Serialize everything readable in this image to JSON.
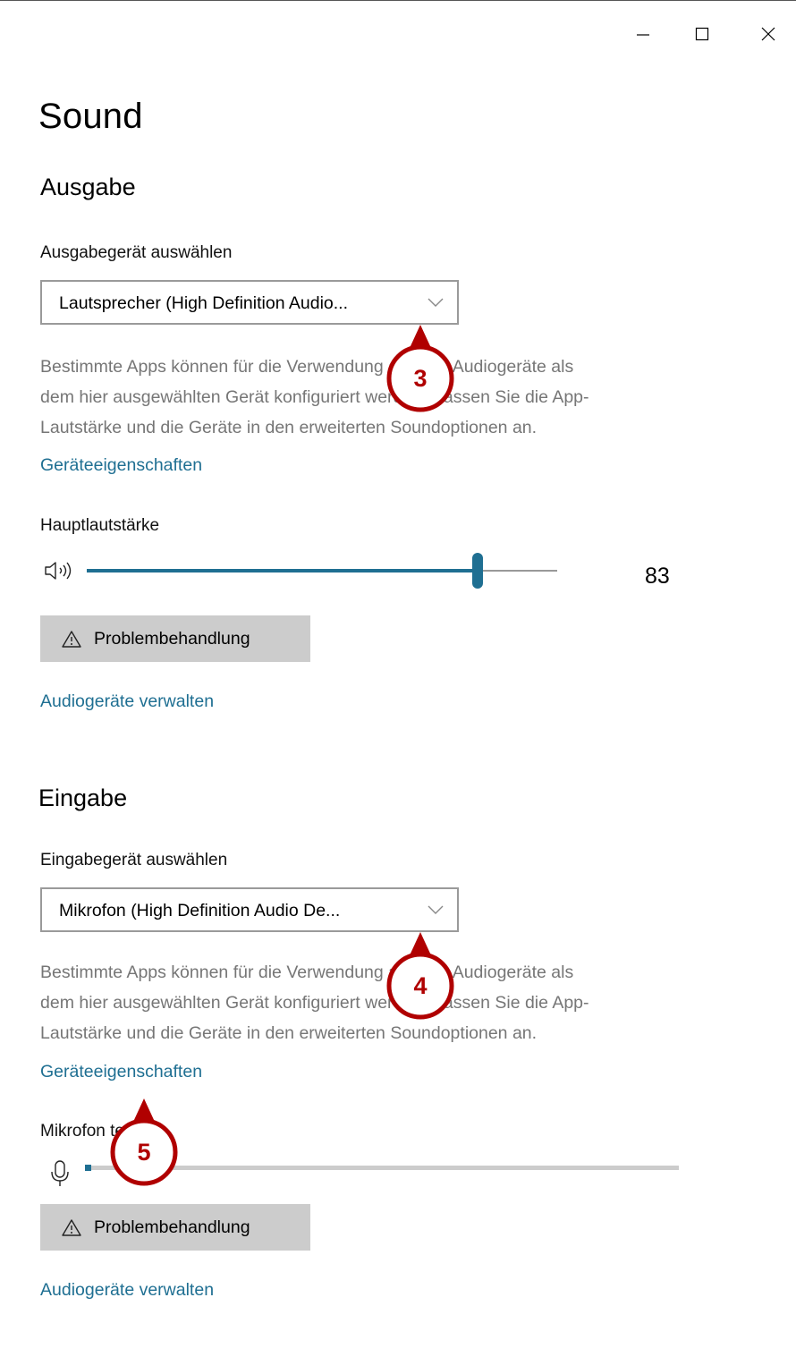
{
  "window": {
    "minimize_icon": "minimize-icon",
    "maximize_icon": "maximize-icon",
    "close_icon": "close-icon"
  },
  "page": {
    "title": "Sound"
  },
  "output": {
    "heading": "Ausgabe",
    "device_label": "Ausgabegerät auswählen",
    "device_value": "Lautsprecher (High Definition Audio...",
    "description_lines": [
      "Bestimmte Apps können für die Verwendung anderer Audiogeräte als",
      "dem hier ausgewählten Gerät konfiguriert werden. Passen Sie die App-",
      "Lautstärke und die Geräte in den erweiterten Soundoptionen an."
    ],
    "properties_link": "Geräteeigenschaften",
    "volume_label": "Hauptlautstärke",
    "volume_value": "83",
    "volume_level": 0.83,
    "troubleshoot_label": "Problembehandlung",
    "manage_link": "Audiogeräte verwalten"
  },
  "input": {
    "heading": "Eingabe",
    "device_label": "Eingabegerät auswählen",
    "device_value": "Mikrofon (High Definition Audio De...",
    "description_lines": [
      "Bestimmte Apps können für die Verwendung anderer Audiogeräte als",
      "dem hier ausgewählten Gerät konfiguriert werden. Passen Sie die App-",
      "Lautstärke und die Geräte in den erweiterten Soundoptionen an."
    ],
    "properties_link": "Geräteeigenschaften",
    "mic_test_label": "Mikrofon testen",
    "mic_level": 0.01,
    "troubleshoot_label": "Problembehandlung",
    "manage_link": "Audiogeräte verwalten"
  },
  "callouts": [
    "3",
    "4",
    "5"
  ],
  "colors": {
    "accent": "#1f6f92",
    "callout": "#b00000",
    "muted_text": "#767676",
    "button_bg": "#cccccc"
  }
}
